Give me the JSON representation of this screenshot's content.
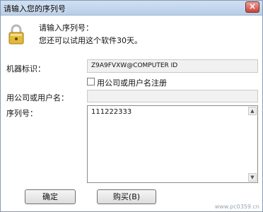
{
  "window": {
    "title": "请输入您的序列号",
    "close_icon": "close-icon",
    "close_symbol": "×"
  },
  "header": {
    "icon": "lock-icon",
    "prompt_title": "请输入序列号：",
    "prompt_subtitle": "您还可以试用这个软件30天。"
  },
  "form": {
    "machine_id_label": "机器标识：",
    "machine_id_value": "Z9A9FVXW@COMPUTER ID",
    "register_checkbox_label": "用公司或用户名注册",
    "register_checkbox_checked": false,
    "company_label": "用公司或用户名：",
    "company_value": "",
    "serial_label": "序列号：",
    "serial_value": "111222333"
  },
  "buttons": {
    "ok_label": "确定",
    "buy_label": "购买(B)"
  },
  "watermark": "www.pc0359.cn"
}
